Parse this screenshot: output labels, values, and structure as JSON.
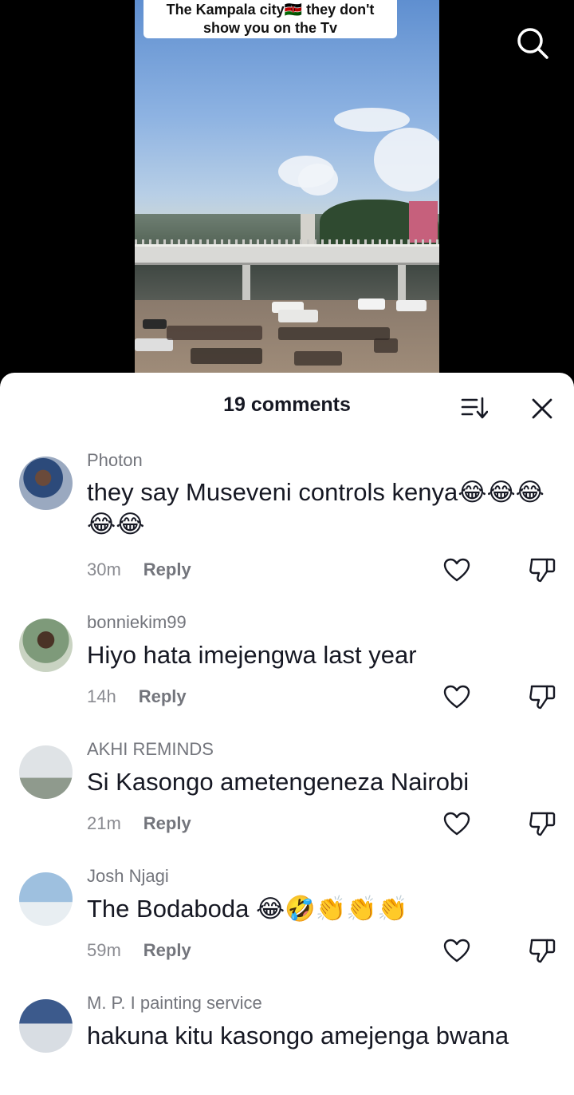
{
  "video": {
    "caption_line1": "The Kampala city🇰🇪 they don't",
    "caption_line2": "show you on the Tv"
  },
  "sheet": {
    "comment_count": "19 comments",
    "reply_label": "Reply"
  },
  "comments": [
    {
      "username": "Photon",
      "text": "they say Museveni controls kenya😂😂😂😂😂",
      "time": "30m"
    },
    {
      "username": "bonniekim99",
      "text": "Hiyo hata imejengwa last year",
      "time": "14h"
    },
    {
      "username": "AKHI REMINDS",
      "text": "Si Kasongo ametengeneza Nairobi",
      "time": "21m"
    },
    {
      "username": "Josh Njagi",
      "text": "The Bodaboda 😂🤣👏👏👏",
      "time": "59m"
    },
    {
      "username": "M. P. I  painting service",
      "text": "hakuna kitu kasongo amejenga bwana",
      "time": ""
    }
  ],
  "icons": {
    "search": "search-icon",
    "sort": "sort-icon",
    "close": "close-icon",
    "like": "heart-icon",
    "dislike": "thumbs-down-icon"
  },
  "colors": {
    "text_primary": "#161823",
    "text_secondary": "#73757c",
    "sheet_bg": "#ffffff"
  }
}
